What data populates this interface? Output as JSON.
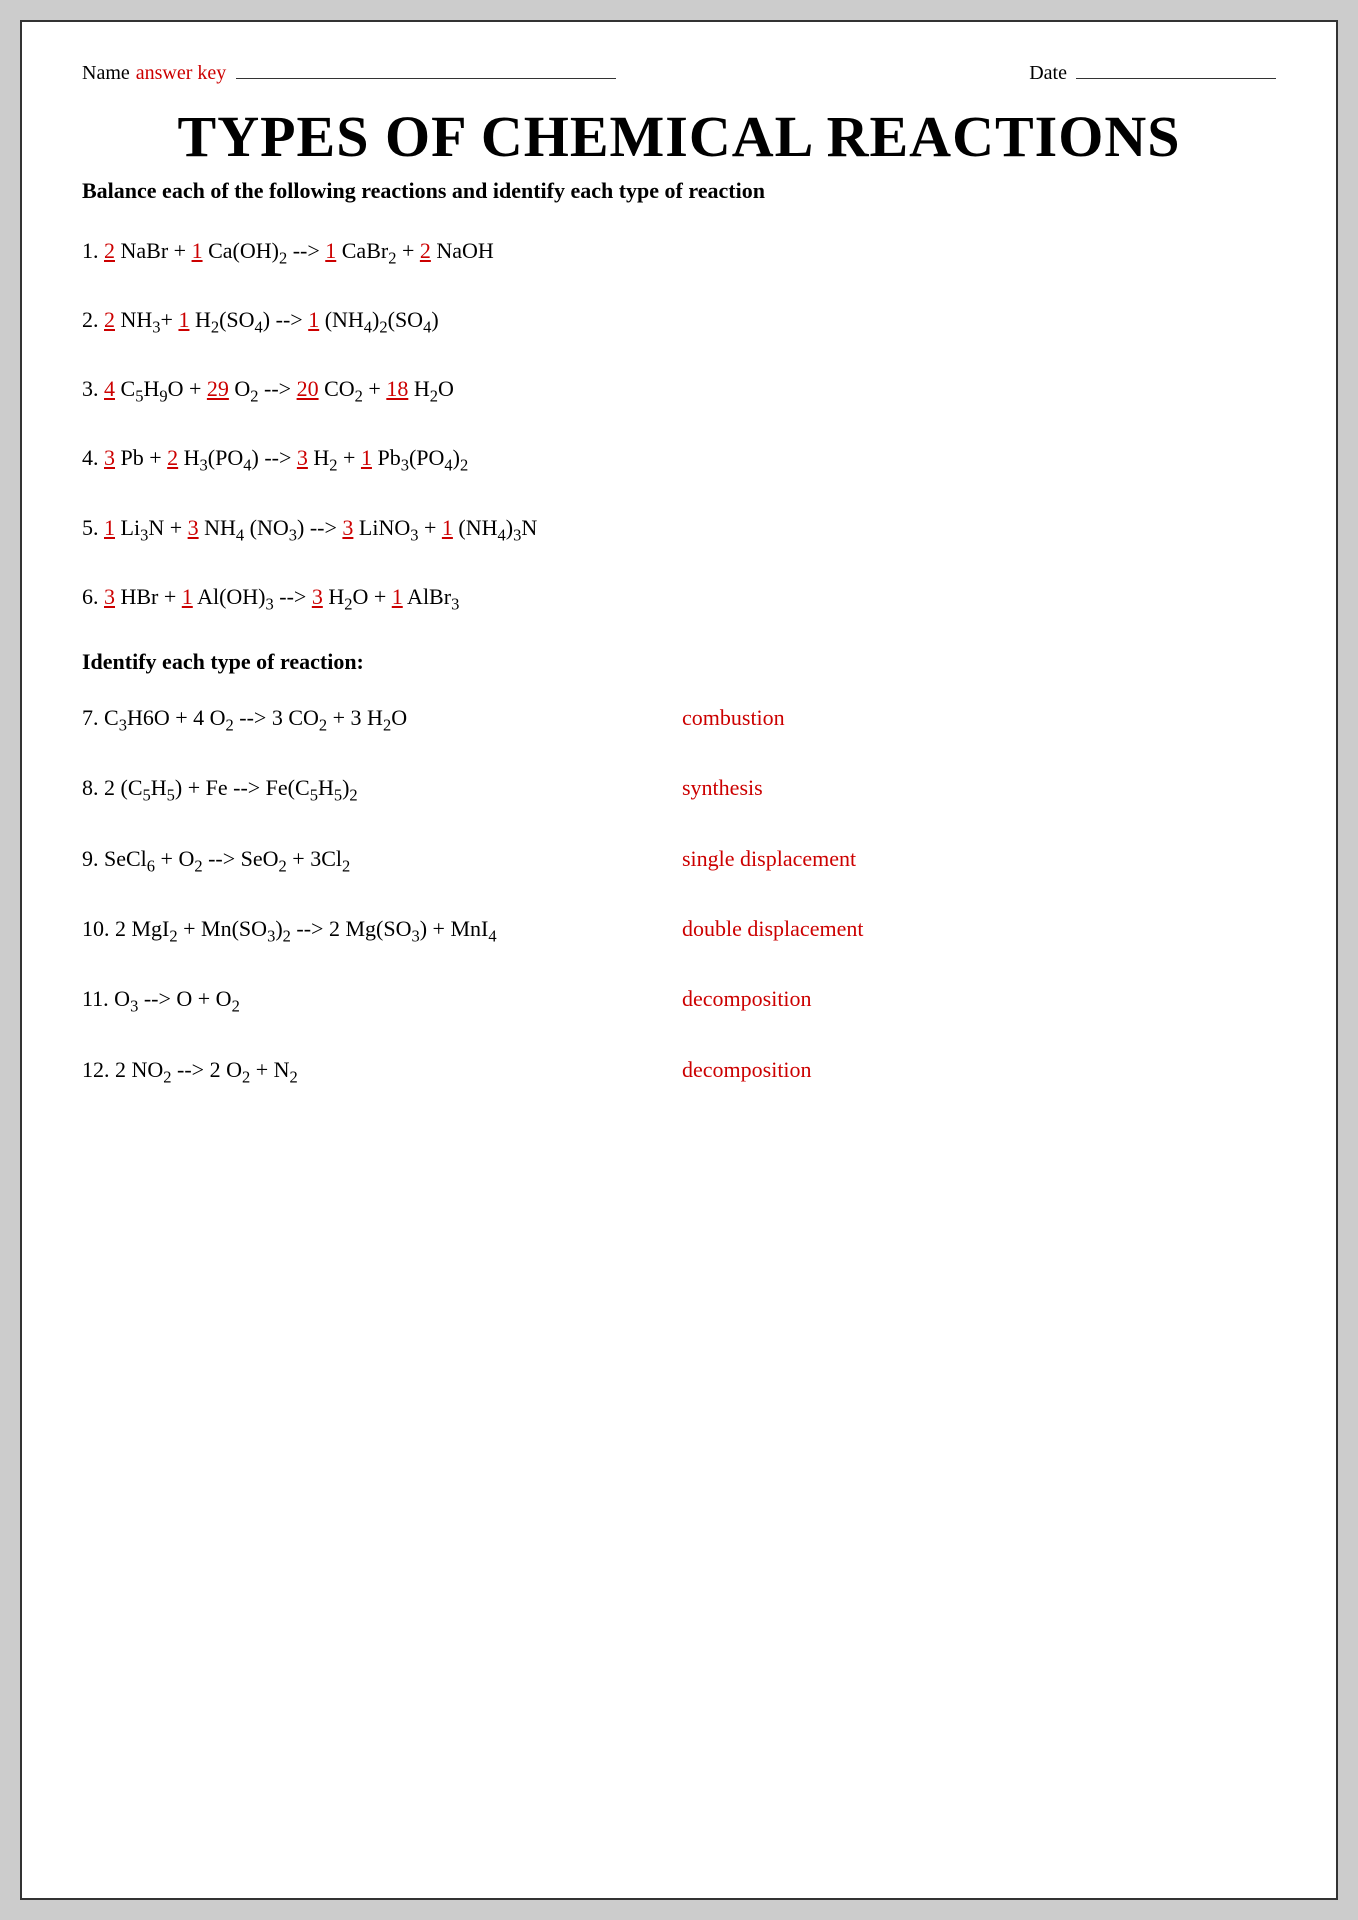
{
  "header": {
    "name_label": "Name",
    "answer_key": "answer key",
    "date_label": "Date"
  },
  "title": "TYPES OF CHEMICAL REACTIONS",
  "subtitle": "Balance each of the following reactions and identify each type of reaction",
  "reactions": [
    {
      "number": "1.",
      "equation_html": "<span class='coeff'>2</span> NaBr + <span class='coeff'>1</span> Ca(OH)<sub>2</sub> --&gt; <span class='coeff'>1</span> CaBr<sub>2</sub> + <span class='coeff'>2</span> NaOH"
    },
    {
      "number": "2.",
      "equation_html": "<span class='coeff'>2</span> NH<sub>3</sub>+ <span class='coeff'>1</span> H<sub>2</sub>(SO<sub>4</sub>) --&gt; <span class='coeff'>1</span> (NH<sub>4</sub>)<sub>2</sub>(SO<sub>4</sub>)"
    },
    {
      "number": "3.",
      "equation_html": "<span class='coeff'>4</span> C<sub>5</sub>H<sub>9</sub>O + <span class='coeff'>29</span> O<sub>2</sub> --&gt; <span class='coeff'>20</span> CO<sub>2</sub> + <span class='coeff'>18</span> H<sub>2</sub>O"
    },
    {
      "number": "4.",
      "equation_html": "<span class='coeff'>3</span> Pb + <span class='coeff'>2</span> H<sub>3</sub>(PO<sub>4</sub>) --&gt; <span class='coeff'>3</span> H<sub>2</sub> + <span class='coeff'>1</span> Pb<sub>3</sub>(PO<sub>4</sub>)<sub>2</sub>"
    },
    {
      "number": "5.",
      "equation_html": "<span class='coeff'>1</span> Li<sub>3</sub>N + <span class='coeff'>3</span> NH<sub>4</sub> (NO<sub>3</sub>) --&gt; <span class='coeff'>3</span> LiNO<sub>3</sub> + <span class='coeff'>1</span> (NH<sub>4</sub>)<sub>3</sub>N"
    },
    {
      "number": "6.",
      "equation_html": "<span class='coeff'>3</span> HBr + <span class='coeff'>1</span> Al(OH)<sub>3</sub> --&gt; <span class='coeff'>3</span> H<sub>2</sub>O + <span class='coeff'>1</span> AlBr<sub>3</sub>"
    }
  ],
  "identify_header": "Identify each type of reaction:",
  "identify_reactions": [
    {
      "number": "7.",
      "equation_html": "C<sub>3</sub>H6O + 4 O<sub>2</sub> --&gt; 3 CO<sub>2</sub> + 3 H<sub>2</sub>O",
      "type": "combustion"
    },
    {
      "number": "8.",
      "equation_html": "2 (C<sub>5</sub>H<sub>5</sub>) + Fe --&gt; Fe(C<sub>5</sub>H<sub>5</sub>)<sub>2</sub>",
      "type": "synthesis"
    },
    {
      "number": "9.",
      "equation_html": "SeCl<sub>6</sub> + O<sub>2</sub> --&gt; SeO<sub>2</sub> + 3Cl<sub>2</sub>",
      "type": "single displacement"
    },
    {
      "number": "10.",
      "equation_html": "2 MgI<sub>2</sub> + Mn(SO<sub>3</sub>)<sub>2</sub> --&gt; 2 Mg(SO<sub>3</sub>) + MnI<sub>4</sub>",
      "type": "double displacement"
    },
    {
      "number": "11.",
      "equation_html": "O<sub>3</sub> --&gt; O + O<sub>2</sub>",
      "type": "decomposition"
    },
    {
      "number": "12.",
      "equation_html": "2 NO<sub>2</sub> --&gt; 2 O<sub>2</sub> + N<sub>2</sub>",
      "type": "decomposition"
    }
  ]
}
